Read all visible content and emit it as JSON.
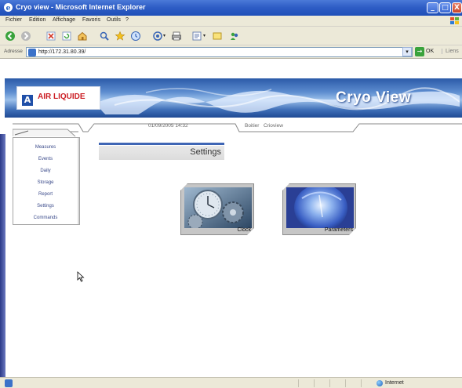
{
  "window": {
    "title": "Cryo view - Microsoft Internet Explorer",
    "min_glyph": "_",
    "max_glyph": "□",
    "close_glyph": "X"
  },
  "menu": {
    "items": [
      "Fichier",
      "Edition",
      "Affichage",
      "Favoris",
      "Outils",
      "?"
    ]
  },
  "address": {
    "label": "Adresse",
    "url": "http://172.31.80.39/",
    "go_label": "OK",
    "links_label": "Liens"
  },
  "banner": {
    "logo_text": "AIR LIQUIDE",
    "logo_mark": "A",
    "brand": "Cryo View"
  },
  "info": {
    "datetime": "01/09/2005 14:32",
    "boitier": "Boitier",
    "device": "Crioview"
  },
  "nav": {
    "items": [
      "Measures",
      "Events",
      "Daily",
      "Storage",
      "Report",
      "Settings",
      "Commands"
    ]
  },
  "page": {
    "title": "Settings"
  },
  "tiles": {
    "clock_label": "Clock",
    "parameters_label": "Parameters"
  },
  "status": {
    "zone": "Internet"
  },
  "colors": {
    "accent": "#3f66b5",
    "logo_red": "#cc1e24",
    "title_blue": "#2f5ec6"
  }
}
